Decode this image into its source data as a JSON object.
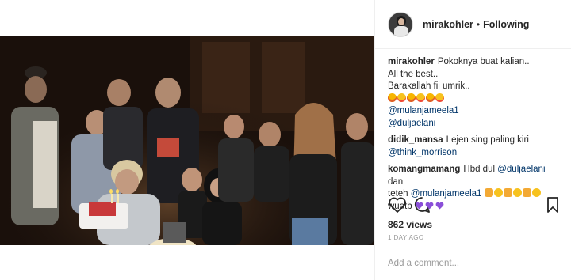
{
  "post": {
    "username": "mirakohler",
    "separator": "•",
    "follow_status": "Following",
    "views": "862 views",
    "date": "1 DAY AGO",
    "add_comment_placeholder": "Add a comment..."
  },
  "caption": {
    "user": "mirakohler",
    "line1": "Pokoknya buat kalian..",
    "line2": "All the best..",
    "line3": "Barakallah fii umrik..",
    "emojis": [
      "laugh-emoji",
      "heart-eyes-emoji",
      "laugh-emoji",
      "heart-eyes-emoji",
      "laugh-emoji",
      "heart-eyes-emoji"
    ],
    "mention1": "@mulanjameela1",
    "mention2": "@duljaelani"
  },
  "comments": [
    {
      "user": "didik_mansa",
      "text": "Lejen sing paling kiri",
      "mention": "@think_morrison"
    },
    {
      "user": "komangmamang",
      "text_a": "Hbd dul",
      "mention_a": "@duljaelani",
      "text_b": "dan",
      "text_c": "teteh",
      "mention_b": "@mulanjameela1",
      "text_d": "wuatb"
    }
  ],
  "colors": {
    "mention": "#003569",
    "text": "#262626",
    "muted": "#999999",
    "heart_purple": "#8a4fd8"
  }
}
